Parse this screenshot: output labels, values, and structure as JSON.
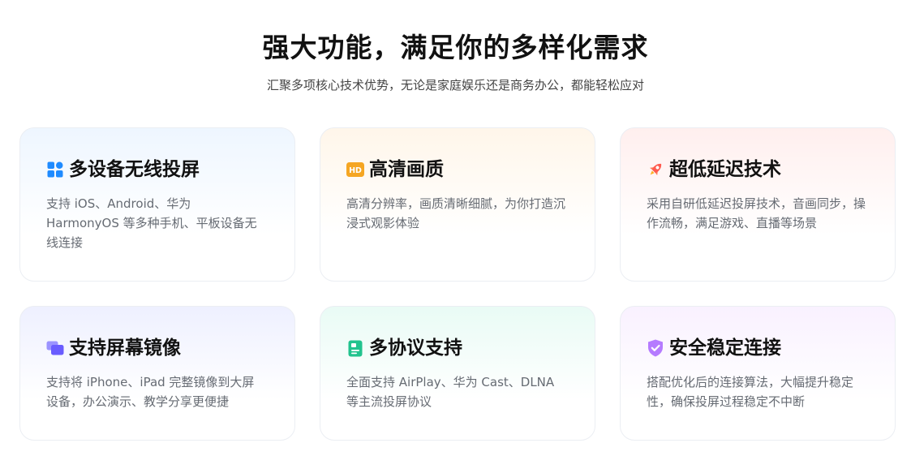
{
  "header": {
    "title": "强大功能，满足你的多样化需求",
    "subtitle": "汇聚多项核心技术优势，无论是家庭娱乐还是商务办公，都能轻松应对"
  },
  "features": [
    {
      "title": "多设备无线投屏",
      "description": "支持 iOS、Android、华为 HarmonyOS 等多种手机、平板设备无线连接",
      "icon": "grid-apps-icon",
      "icon_color": "#1f8bff"
    },
    {
      "title": "高清画质",
      "description": "高清分辨率，画质清晰细腻，为你打造沉浸式观影体验",
      "icon": "hd-icon",
      "icon_label": "HD",
      "icon_color": "#f5a623"
    },
    {
      "title": "超低延迟技术",
      "description": "采用自研低延迟投屏技术，音画同步，操作流畅，满足游戏、直播等场景",
      "icon": "rocket-icon",
      "icon_color": "#ff5a4e"
    },
    {
      "title": "支持屏幕镜像",
      "description": "支持将 iPhone、iPad 完整镜像到大屏设备，办公演示、教学分享更便捷",
      "icon": "mirror-screens-icon",
      "icon_color": "#6a5cff"
    },
    {
      "title": "多协议支持",
      "description": "全面支持 AirPlay、华为 Cast、DLNA 等主流投屏协议",
      "icon": "document-icon",
      "icon_color": "#22c38e"
    },
    {
      "title": "安全稳定连接",
      "description": "搭配优化后的连接算法，大幅提升稳定性，确保投屏过程稳定不中断",
      "icon": "shield-check-icon",
      "icon_color": "#b57bff"
    }
  ]
}
